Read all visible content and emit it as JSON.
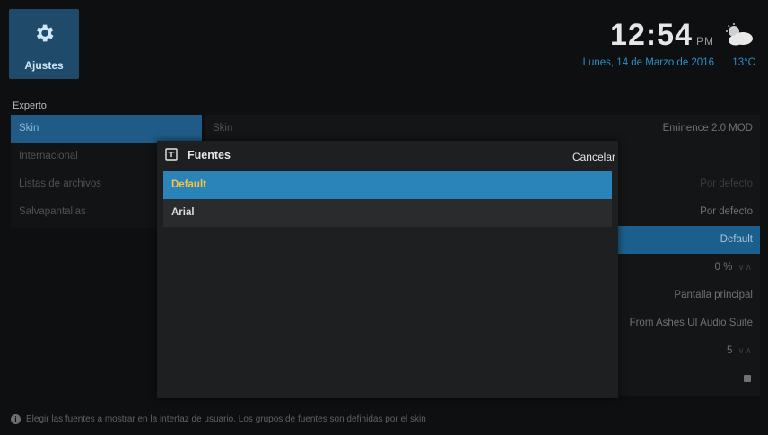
{
  "app": {
    "tile_label": "Ajustes",
    "tile_icon": "gear-icon"
  },
  "header": {
    "time": "12:54",
    "ampm": "PM",
    "date": "Lunes, 14 de Marzo de 2016",
    "temperature": "13°C",
    "weather_icon": "cloudy-icon"
  },
  "section_label": "Experto",
  "menu": {
    "items": [
      {
        "label": "Skin"
      },
      {
        "label": "Internacional"
      },
      {
        "label": "Listas de archivos"
      },
      {
        "label": "Salvapantallas"
      }
    ]
  },
  "panel": {
    "rows": [
      {
        "left": "Skin",
        "right": "Eminence 2.0 MOD"
      },
      {
        "left": "",
        "right": ""
      },
      {
        "left": "",
        "right": "Por defecto"
      },
      {
        "left": "",
        "right": "Por defecto"
      },
      {
        "left": "",
        "right": "Default"
      },
      {
        "left": "",
        "right": "0 %"
      },
      {
        "left": "",
        "right": "Pantalla principal"
      },
      {
        "left": "",
        "right": "From Ashes UI Audio Suite"
      },
      {
        "left": "",
        "right": "5"
      },
      {
        "left": "",
        "right": ""
      }
    ]
  },
  "dialog": {
    "title": "Fuentes",
    "cancel": "Cancelar",
    "options": [
      {
        "label": "Default",
        "selected": true
      },
      {
        "label": "Arial",
        "selected": false
      }
    ]
  },
  "help_text": "Elegir las fuentes a mostrar en la interfaz de usuario. Los grupos de fuentes son definidas por el skin",
  "colors": {
    "accent": "#2a84ba",
    "selected_text": "#f5c542",
    "clock_date": "#2b90c6"
  }
}
